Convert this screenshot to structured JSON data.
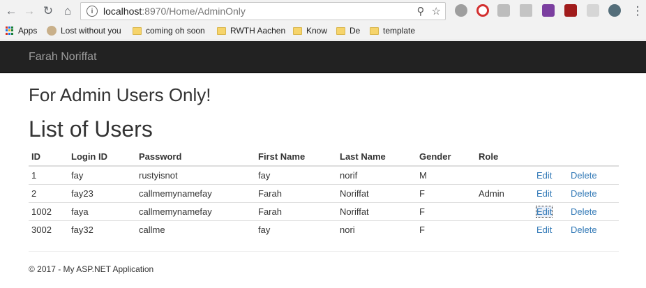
{
  "browser": {
    "url_host": "localhost",
    "url_path": ":8970/Home/AdminOnly"
  },
  "bookmarks": [
    {
      "label": "Apps",
      "icon": "apps-grid-icon"
    },
    {
      "label": "Lost without you",
      "icon": "avatar-icon"
    },
    {
      "label": "coming oh soon",
      "icon": "folder-icon"
    },
    {
      "label": "RWTH Aachen",
      "icon": "folder-icon"
    },
    {
      "label": "Know",
      "icon": "folder-icon"
    },
    {
      "label": "De",
      "icon": "folder-icon"
    },
    {
      "label": "template",
      "icon": "folder-icon"
    }
  ],
  "navbar": {
    "brand": "Farah Noriffat",
    "background": "#222222"
  },
  "page": {
    "subtitle": "For Admin Users Only!",
    "title": "List of Users"
  },
  "table": {
    "headers": [
      "ID",
      "Login ID",
      "Password",
      "First Name",
      "Last Name",
      "Gender",
      "Role",
      "",
      ""
    ],
    "rows": [
      {
        "id": "1",
        "login": "fay",
        "password": "rustyisnot",
        "first": "fay",
        "last": "norif",
        "gender": "M",
        "role": "",
        "edit": "Edit",
        "delete": "Delete"
      },
      {
        "id": "2",
        "login": "fay23",
        "password": "callmemynamefay",
        "first": "Farah",
        "last": "Noriffat",
        "gender": "F",
        "role": "Admin",
        "edit": "Edit",
        "delete": "Delete"
      },
      {
        "id": "1002",
        "login": "faya",
        "password": "callmemynamefay",
        "first": "Farah",
        "last": "Noriffat",
        "gender": "F",
        "role": "",
        "edit": "Edit",
        "delete": "Delete"
      },
      {
        "id": "3002",
        "login": "fay32",
        "password": "callme",
        "first": "fay",
        "last": "nori",
        "gender": "F",
        "role": "",
        "edit": "Edit",
        "delete": "Delete"
      }
    ],
    "link_color": "#337ab7"
  },
  "footer": {
    "text": "© 2017 - My ASP.NET Application"
  }
}
